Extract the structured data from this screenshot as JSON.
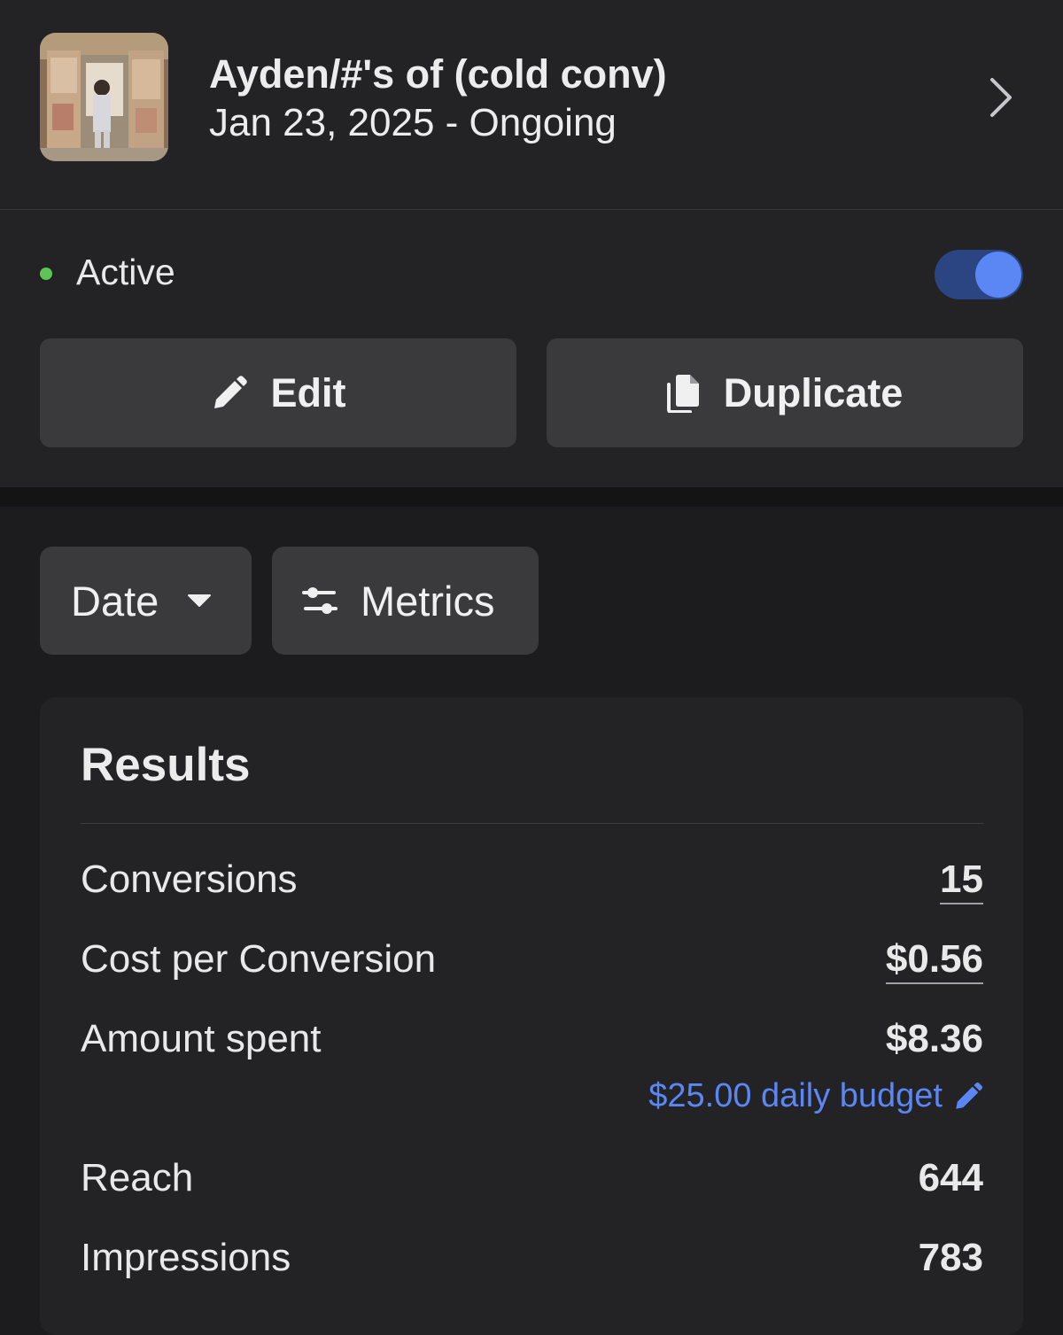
{
  "campaign": {
    "name": "Ayden/#'s of (cold conv)",
    "dates": "Jan 23, 2025 -  Ongoing"
  },
  "status": {
    "label": "Active",
    "dot_color": "#5ec453",
    "toggle_on": true
  },
  "actions": {
    "edit_label": "Edit",
    "duplicate_label": "Duplicate"
  },
  "filters": {
    "date_label": "Date",
    "metrics_label": "Metrics"
  },
  "results": {
    "title": "Results",
    "rows": [
      {
        "label": "Conversions",
        "value": "15"
      },
      {
        "label": "Cost per Conversion",
        "value": "$0.56"
      },
      {
        "label": "Amount spent",
        "value": "$8.36"
      },
      {
        "label": "Reach",
        "value": "644"
      },
      {
        "label": "Impressions",
        "value": "783"
      }
    ],
    "budget_link": "$25.00 daily budget"
  },
  "colors": {
    "accent": "#5b87f5",
    "background": "#1c1c1e",
    "surface": "#232325",
    "button": "#3a3a3c"
  }
}
